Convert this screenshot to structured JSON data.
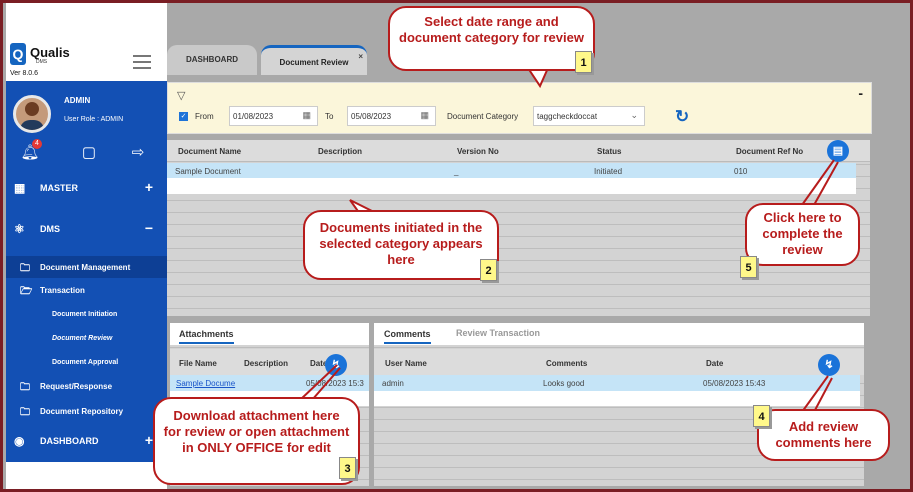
{
  "app": {
    "name": "Qualis",
    "sub": "DMS",
    "version": "Ver 8.0.6"
  },
  "user": {
    "name": "ADMIN",
    "role": "User Role : ADMIN",
    "notifications": "4"
  },
  "sidebar": {
    "master": "MASTER",
    "dms": "DMS",
    "items": [
      "Document Management",
      "Transaction",
      "Request/Response",
      "Document Repository"
    ],
    "transaction_items": [
      "Document Initiation",
      "Document Review",
      "Document Approval"
    ],
    "dashboard": "DASHBOARD"
  },
  "tabs": {
    "dashboard": "DASHBOARD",
    "review": "Document Review",
    "close": "×"
  },
  "filter": {
    "from_label": "From",
    "from_value": "01/08/2023",
    "to_label": "To",
    "to_value": "05/08/2023",
    "category_label": "Document Category",
    "category_value": "taggcheckdoccat",
    "collapse": "-"
  },
  "grid": {
    "headers": [
      "Document Name",
      "Description",
      "Version No",
      "Status",
      "Document Ref No"
    ],
    "rows": [
      {
        "name": "Sample Document",
        "description": "",
        "version": "_",
        "status": "Initiated",
        "ref": "010"
      }
    ]
  },
  "attachments": {
    "tab": "Attachments",
    "headers": [
      "File Name",
      "Description",
      "Date"
    ],
    "row": {
      "file": "Sample Docume",
      "description": "",
      "date": "05/08/2023 15:3"
    }
  },
  "comments": {
    "tabs": [
      "Comments",
      "Review Transaction"
    ],
    "headers": [
      "User Name",
      "Comments",
      "Date"
    ],
    "row": {
      "user": "admin",
      "comment": "Looks good",
      "date": "05/08/2023 15:43"
    }
  },
  "callouts": {
    "c1": "Select date range and document category for review",
    "c2": "Documents initiated in the selected category appears here",
    "c3": "Download attachment here for review or open attachment in ONLY OFFICE for edit",
    "c4": "Add review comments here",
    "c5": "Click here to complete the review"
  },
  "numbers": [
    "1",
    "2",
    "3",
    "4",
    "5"
  ]
}
